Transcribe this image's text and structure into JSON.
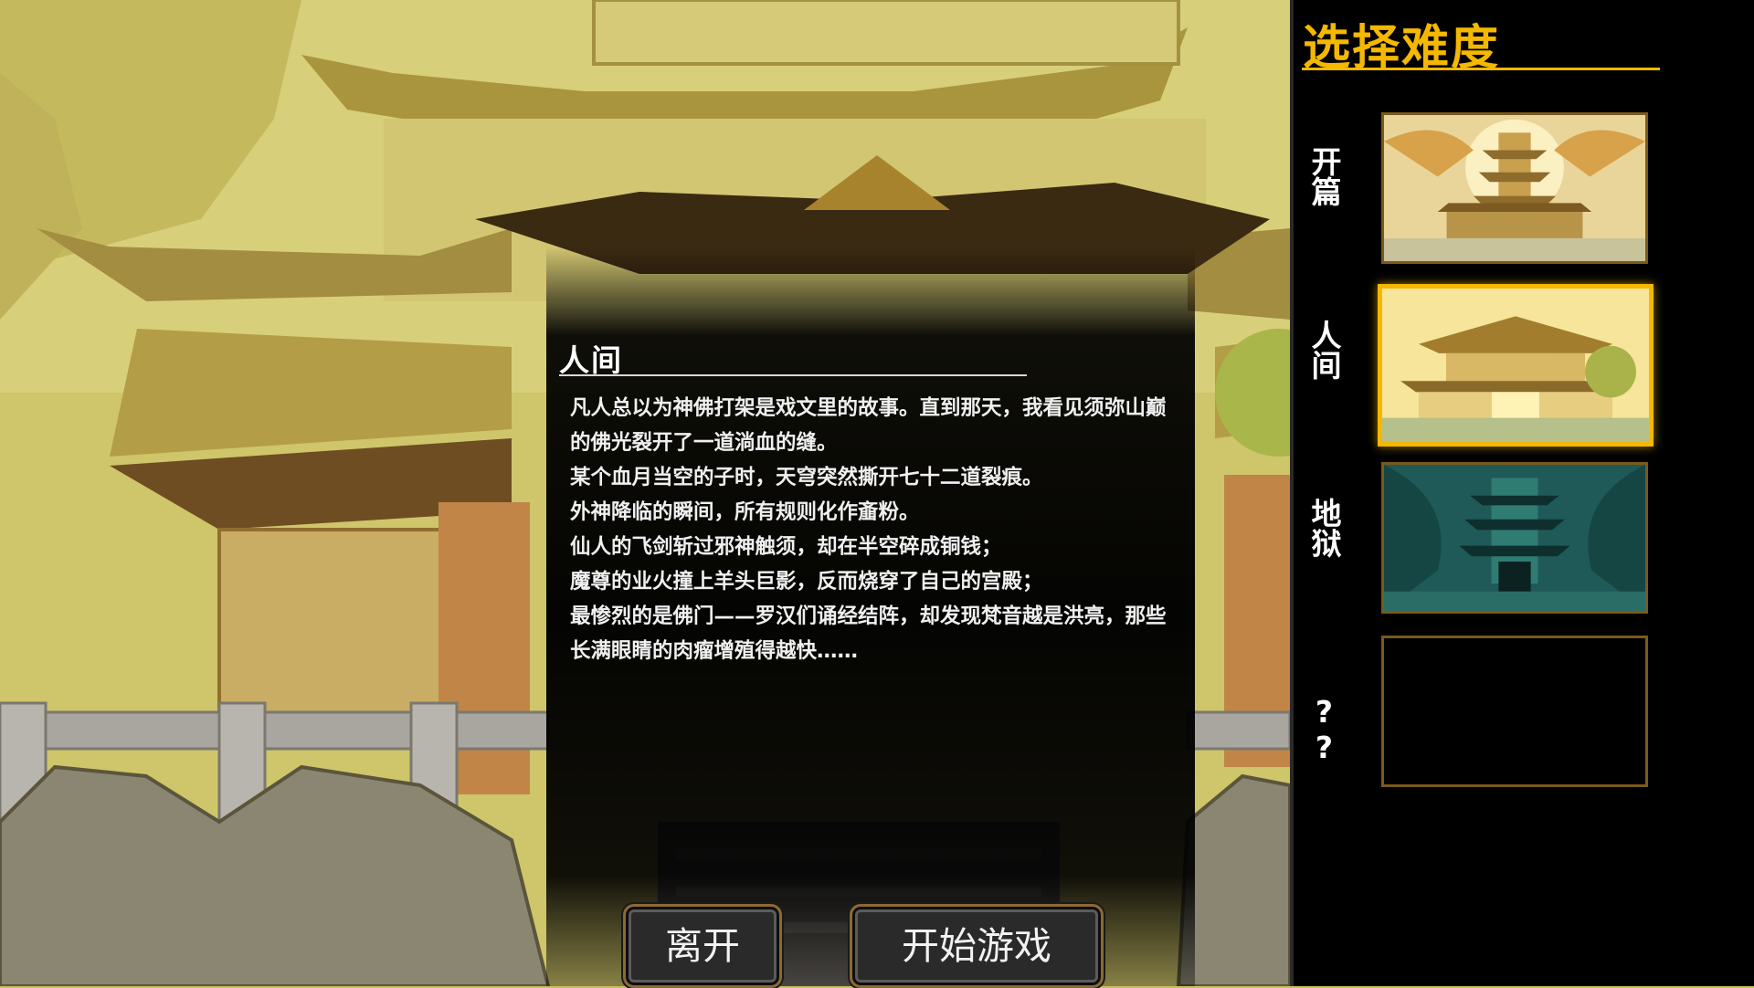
{
  "sidebar": {
    "title": "选择难度",
    "accent": "#f4b800",
    "difficulties": [
      {
        "label": "开篇",
        "theme": "golden-pagoda",
        "selected": false
      },
      {
        "label": "人间",
        "theme": "yellow-temple",
        "selected": true
      },
      {
        "label": "地狱",
        "theme": "teal-hell-pagoda",
        "selected": false
      },
      {
        "label": "??",
        "theme": "locked",
        "selected": false
      }
    ]
  },
  "panel": {
    "title": "人间",
    "lines": [
      "凡人总以为神佛打架是戏文里的故事。直到那天，我看见须弥山巅的佛光裂开了一道淌血的缝。",
      "某个血月当空的子时，天穹突然撕开七十二道裂痕。",
      "外神降临的瞬间，所有规则化作齑粉。",
      "仙人的飞剑斩过邪神触须，却在半空碎成铜钱；",
      "魔尊的业火撞上羊头巨影，反而烧穿了自己的宫殿；",
      "最惨烈的是佛门——罗汉们诵经结阵，却发现梵音越是洪亮，那些长满眼睛的肉瘤增殖得越快……"
    ]
  },
  "buttons": {
    "leave": "离开",
    "start": "开始游戏"
  }
}
